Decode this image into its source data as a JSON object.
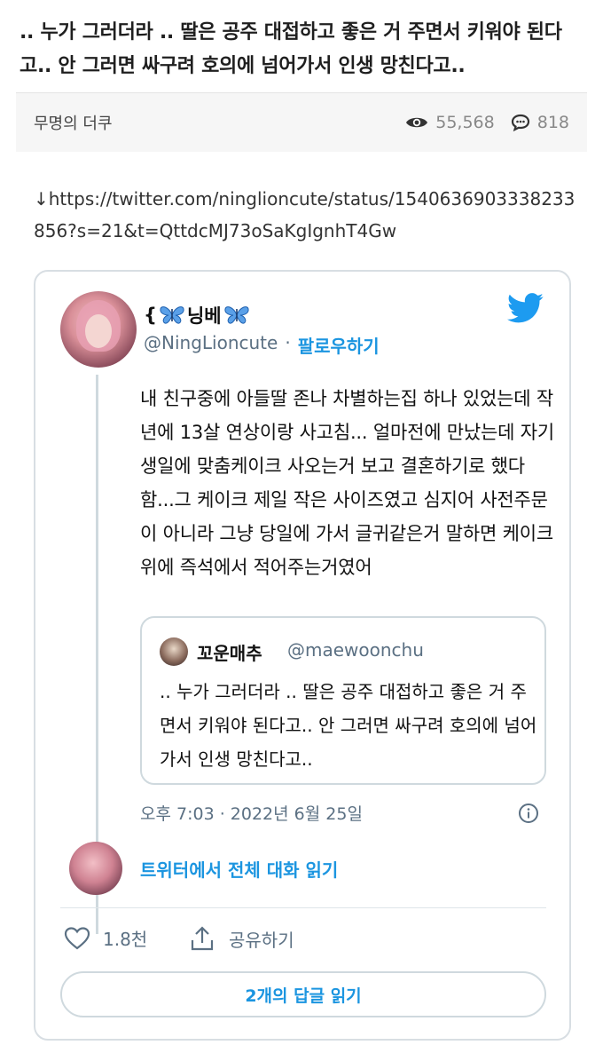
{
  "post": {
    "title": ".. 누가 그러더라 .. 딸은 공주 대접하고 좋은 거 주면서 키워야 된다고.. 안 그러면 싸구려 호의에 넘어가서 인생 망친다고..",
    "category": "무명의 더쿠",
    "views": "55,568",
    "comments": "818",
    "link": "↓https://twitter.com/ninglioncute/status/1540636903338233856?s=21&t=QttdcMJ73oSaKgIgnhT4Gw"
  },
  "tweet": {
    "display_name": "{🦋닝베🦋",
    "name_prefix": "{",
    "name_core": "닝베",
    "handle": "@NingLioncute",
    "separator": "·",
    "follow_label": "팔로우하기",
    "text": "내 친구중에 아들딸 존나 차별하는집 하나 있었는데 작년에 13살 연상이랑 사고침... 얼마전에 만났는데 자기 생일에 맞춤케이크 사오는거 보고 결혼하기로 했다함...그 케이크 제일 작은 사이즈였고 심지어 사전주문이 아니라 그냥 당일에 가서 글귀같은거 말하면 케이크 위에 즉석에서 적어주는거였어",
    "quote": {
      "name": "꼬운매추",
      "handle": "@maewoonchu",
      "text": ".. 누가 그러더라 .. 딸은 공주 대접하고 좋은 거 주면서 키워야 된다고.. 안 그러면 싸구려 호의에 넘어가서 인생 망친다고.."
    },
    "timestamp": "오후 7:03 · 2022년 6월 25일",
    "read_conversation": "트위터에서 전체 대화 읽기",
    "likes": "1.8천",
    "share_label": "공유하기",
    "replies_label": "2개의 답글 읽기"
  },
  "icons": {
    "views": "eye-icon",
    "comments": "speech-bubble-icon",
    "brand": "twitter-bird-icon",
    "info": "info-icon",
    "like": "heart-icon",
    "share": "share-icon",
    "name_decoration": "butterfly-icon"
  },
  "colors": {
    "link_blue": "#1b95e0",
    "muted_gray": "#5b7083",
    "meta_bg": "#f6f6f6"
  }
}
